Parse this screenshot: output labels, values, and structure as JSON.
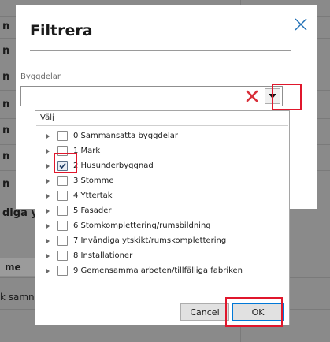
{
  "background": {
    "row_labels": [
      "n",
      "n",
      "n",
      "n",
      "n",
      "n",
      "n",
      "n"
    ],
    "truncated_label": "diga y",
    "column_header": "me",
    "cell_text": "k samn"
  },
  "dialog": {
    "title": "Filtrera",
    "close_icon": "close-icon",
    "field_label": "Byggdelar",
    "combo_value": ""
  },
  "dropdown": {
    "header": "Välj",
    "items": [
      {
        "label": "0 Sammansatta byggdelar",
        "checked": false
      },
      {
        "label": "1 Mark",
        "checked": false
      },
      {
        "label": "2 Husunderbyggnad",
        "checked": true
      },
      {
        "label": "3 Stomme",
        "checked": false
      },
      {
        "label": "4 Yttertak",
        "checked": false
      },
      {
        "label": "5 Fasader",
        "checked": false
      },
      {
        "label": "6 Stomkomplettering/rumsbildning",
        "checked": false
      },
      {
        "label": "7 Invändiga ytskikt/rumskomplettering",
        "checked": false
      },
      {
        "label": "8 Installationer",
        "checked": false
      },
      {
        "label": "9 Gemensamma arbeten/tillfälliga fabriken",
        "checked": false
      }
    ],
    "cancel_label": "Cancel",
    "ok_label": "OK"
  },
  "colors": {
    "highlight": "#e0172c",
    "clear_x": "#d9303a",
    "accent": "#126b7c"
  }
}
